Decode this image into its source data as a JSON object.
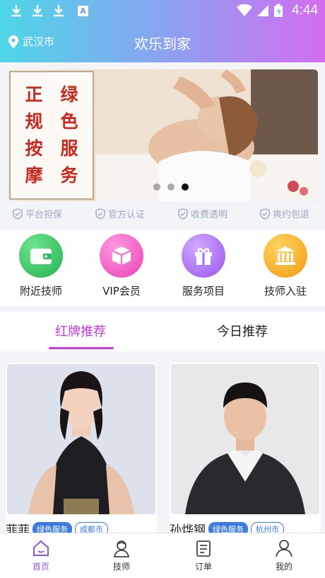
{
  "status_bar": {
    "time": "4:44",
    "icons": [
      "download-icon",
      "download-icon",
      "download-icon",
      "a-badge-icon",
      "wifi-icon",
      "signal-icon",
      "battery-icon"
    ],
    "badge_letter": "A"
  },
  "header": {
    "location": "武汉市",
    "title": "欢乐到家"
  },
  "banner": {
    "text_left": [
      "正",
      "规",
      "按",
      "摩"
    ],
    "text_right": [
      "绿",
      "色",
      "服",
      "务"
    ],
    "slides": 3,
    "active_slide": 3
  },
  "guarantees": [
    "平台担保",
    "官方认证",
    "收费透明",
    "爽约包退"
  ],
  "features": [
    {
      "label": "附近技师",
      "icon": "wallet-icon",
      "color": "#2dbd5c"
    },
    {
      "label": "VIP会员",
      "icon": "box-icon",
      "color": "#f058c6"
    },
    {
      "label": "服务项目",
      "icon": "gift-icon",
      "color": "#a66cf2"
    },
    {
      "label": "技师入驻",
      "icon": "bank-icon",
      "color": "#f5a623"
    }
  ],
  "tabs": [
    "红牌推荐",
    "今日推荐"
  ],
  "cards": [
    {
      "name": "菲菲",
      "service_tag": "绿色服务",
      "city": "成都市"
    },
    {
      "name": "孙烨钢",
      "service_tag": "绿色服务",
      "city": "杭州市"
    }
  ],
  "bottom_nav": [
    {
      "label": "首页",
      "icon": "home-icon",
      "active": true
    },
    {
      "label": "技师",
      "icon": "technician-icon",
      "active": false
    },
    {
      "label": "订单",
      "icon": "order-icon",
      "active": false
    },
    {
      "label": "我的",
      "icon": "user-icon",
      "active": false
    }
  ],
  "colors": {
    "accent": "#c43be0",
    "nav_active": "#8a54e8",
    "tag_blue": "#3b7be3",
    "banner_red": "#c8281e"
  }
}
